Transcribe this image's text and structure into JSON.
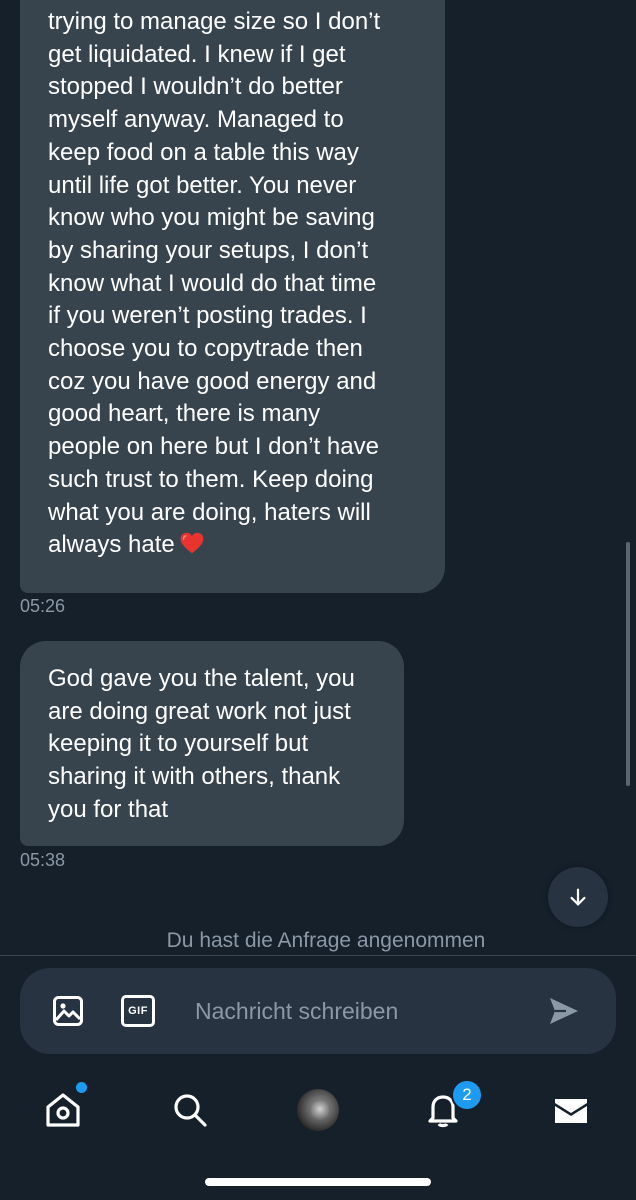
{
  "conversation": {
    "messages": [
      {
        "lines": [
          "trying to manage size so I don’t",
          "get liquidated. I knew if I get",
          "stopped I wouldn’t do better",
          "myself anyway. Managed to",
          "keep food on a table this way",
          "until life got better. You never",
          "know who you might be saving",
          "by sharing your setups, I don’t",
          "know what I would do that time",
          "if you weren’t posting trades. I",
          "choose you to copytrade then",
          "coz you have good energy and",
          "good heart, there is many",
          "people on here but I don’t have",
          "such trust to them. Keep doing",
          "what you are doing, haters will",
          "always hate"
        ],
        "time": "05:26"
      },
      {
        "lines": [
          "God gave you the talent, you",
          "are doing great work not just",
          "keeping it to yourself but",
          "sharing it with others, thank",
          "you for that"
        ],
        "time": "05:38"
      }
    ],
    "system_note": "Du hast die Anfrage angenommen"
  },
  "composer": {
    "placeholder": "Nachricht schreiben",
    "value": "",
    "gif_label": "GIF"
  },
  "nav": {
    "notifications_badge": "2"
  },
  "colors": {
    "background": "#15202b",
    "bubble": "#38444d",
    "accent": "#1d9bf0",
    "secondary_text": "#8b98a5"
  },
  "icons": [
    "media-icon",
    "gif-icon",
    "send-icon",
    "home-icon",
    "search-icon",
    "bell-icon",
    "mail-icon",
    "arrow-down-icon",
    "heart-emoji"
  ]
}
